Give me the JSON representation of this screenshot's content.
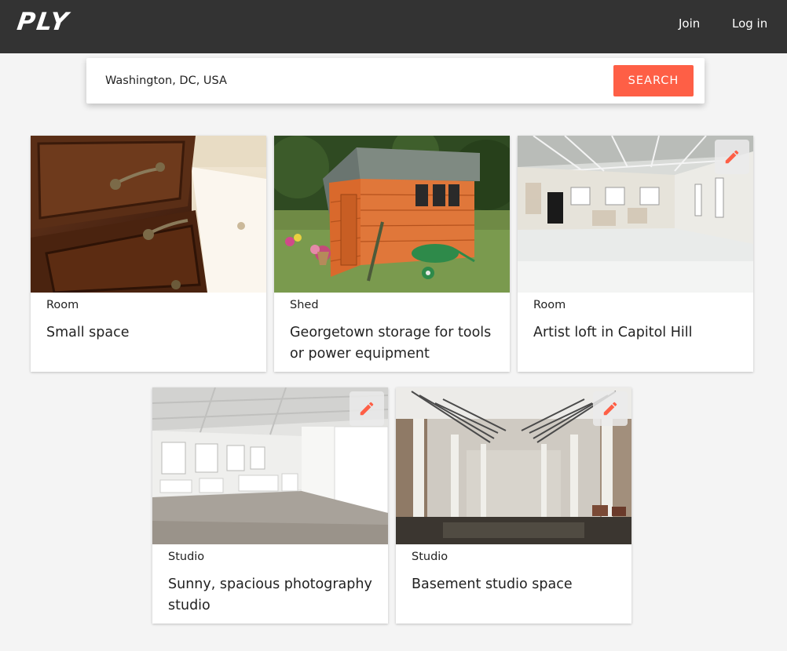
{
  "header": {
    "logo": "PLY",
    "join_label": "Join",
    "login_label": "Log in"
  },
  "search": {
    "value": "Washington, DC, USA",
    "button_label": "SEARCH"
  },
  "colors": {
    "accent": "#fe5f46",
    "topbar": "#333333",
    "background": "#f4f4f4"
  },
  "listings": [
    {
      "type": "Room",
      "title": "Small space",
      "editable": false
    },
    {
      "type": "Shed",
      "title": "Georgetown storage for tools or power equipment",
      "editable": false
    },
    {
      "type": "Room",
      "title": "Artist loft in Capitol Hill",
      "editable": true
    },
    {
      "type": "Studio",
      "title": "Sunny, spacious photography studio",
      "editable": true
    },
    {
      "type": "Studio",
      "title": "Basement studio space",
      "editable": true
    }
  ],
  "icons": {
    "edit": "pencil-icon"
  }
}
